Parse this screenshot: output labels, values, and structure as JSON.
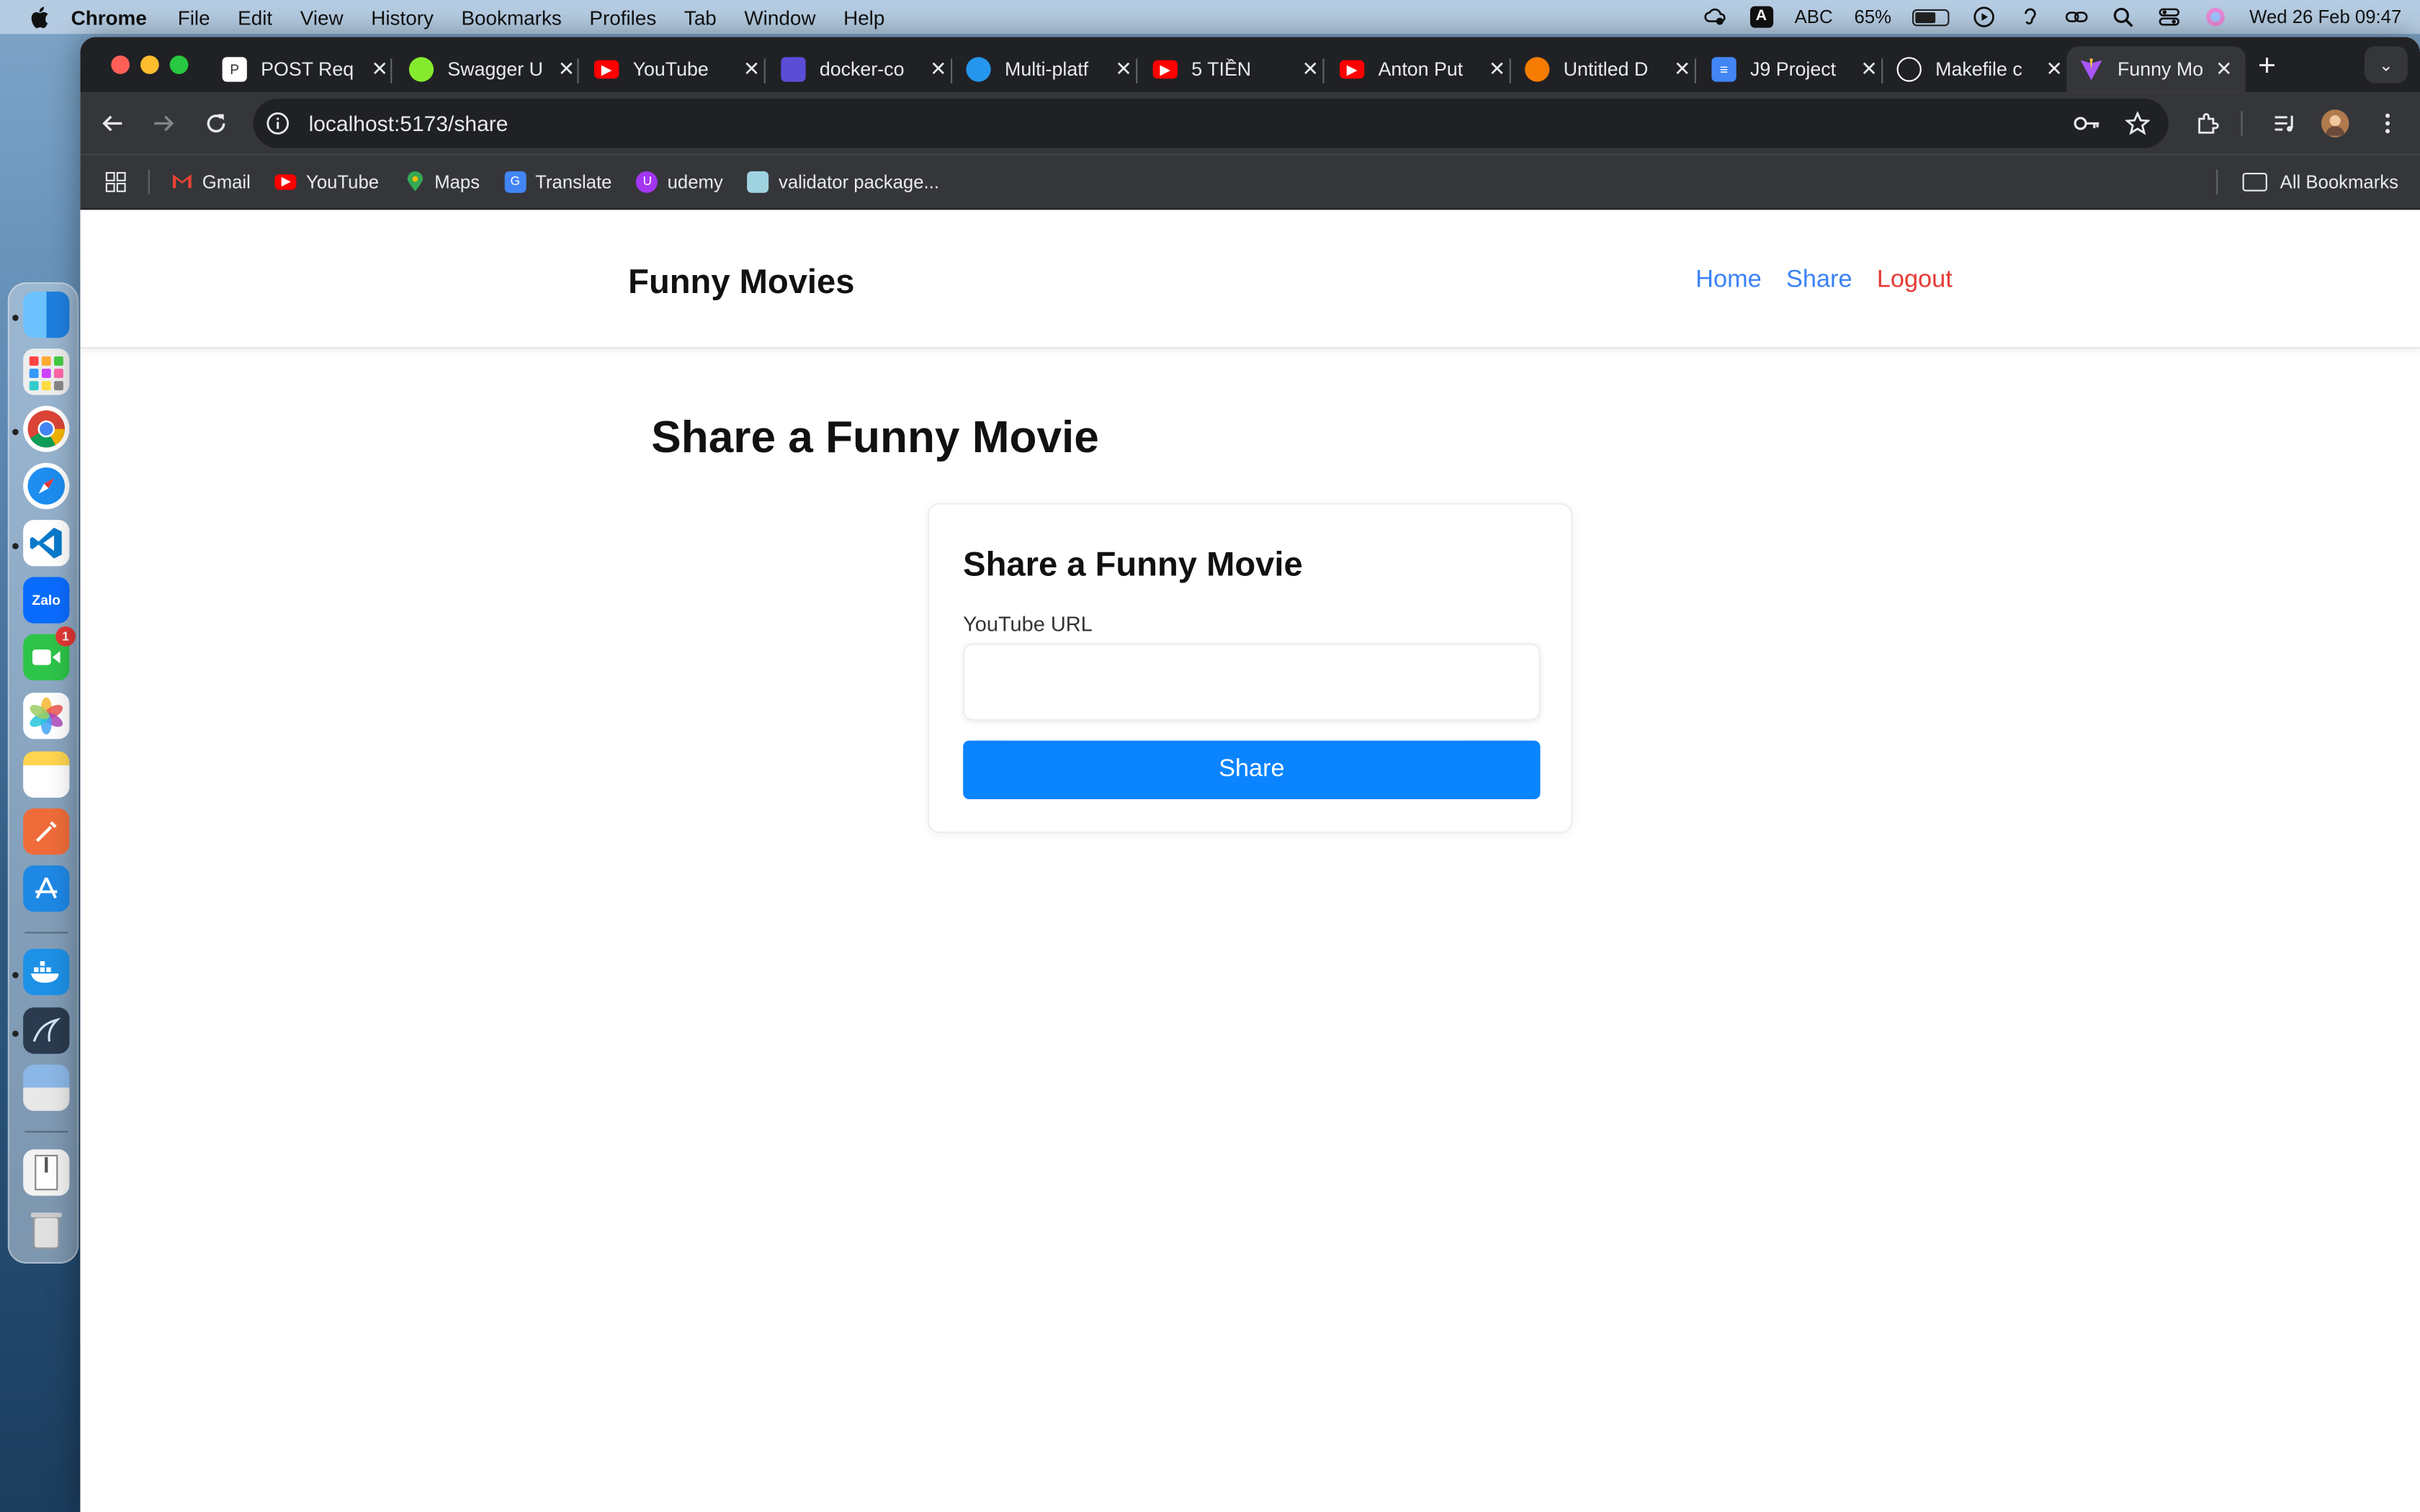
{
  "menubar": {
    "app": "Chrome",
    "items": [
      "File",
      "Edit",
      "View",
      "History",
      "Bookmarks",
      "Profiles",
      "Tab",
      "Window",
      "Help"
    ],
    "input_badge": "A",
    "input_source": "ABC",
    "battery_percent": "65%",
    "battery_level": 0.65,
    "datetime": "Wed 26 Feb  09:47"
  },
  "tabs": [
    {
      "title": "POST Req",
      "icon": "postman-icon",
      "color": "#ffffff"
    },
    {
      "title": "Swagger U",
      "icon": "swagger-icon",
      "color": "#85ea2d"
    },
    {
      "title": "YouTube",
      "icon": "youtube-icon",
      "color": "#ff0000"
    },
    {
      "title": "docker-co",
      "icon": "docs-icon",
      "color": "#5b4dd6"
    },
    {
      "title": "Multi-platf",
      "icon": "docker-icon",
      "color": "#2496ed"
    },
    {
      "title": "5 TIỀN",
      "icon": "youtube-icon",
      "color": "#ff0000"
    },
    {
      "title": "Anton Put",
      "icon": "youtube-icon",
      "color": "#ff0000"
    },
    {
      "title": "Untitled D",
      "icon": "diagram-icon",
      "color": "#f57c00"
    },
    {
      "title": "J9 Project",
      "icon": "gdocs-icon",
      "color": "#4285f4"
    },
    {
      "title": "Makefile c",
      "icon": "openai-icon",
      "color": "#ffffff"
    },
    {
      "title": "Funny Mo",
      "icon": "vite-icon",
      "color": "#a855f7",
      "active": true
    }
  ],
  "address_bar": {
    "url": "localhost:5173/share"
  },
  "bookmarks": [
    {
      "label": "Gmail",
      "icon": "gmail-icon",
      "color": "#ea4335"
    },
    {
      "label": "YouTube",
      "icon": "youtube-icon",
      "color": "#ff0000"
    },
    {
      "label": "Maps",
      "icon": "maps-icon",
      "color": "#34a853"
    },
    {
      "label": "Translate",
      "icon": "translate-icon",
      "color": "#4285f4"
    },
    {
      "label": "udemy",
      "icon": "udemy-icon",
      "color": "#a435f0"
    },
    {
      "label": "validator package...",
      "icon": "package-icon",
      "color": "#9fd3e0"
    }
  ],
  "all_bookmarks": "All Bookmarks",
  "dock": {
    "facetime_badge": "1",
    "zalo_label": "Zalo"
  },
  "app": {
    "brand": "Funny Movies",
    "nav": {
      "home": "Home",
      "share": "Share",
      "logout": "Logout"
    },
    "page_title": "Share a Funny Movie",
    "card": {
      "title": "Share a Funny Movie",
      "field_label": "YouTube URL",
      "field_value": "",
      "button": "Share"
    }
  },
  "colors": {
    "link": "#3b82f6",
    "logout": "#e53935",
    "button": "#0a84ff"
  }
}
